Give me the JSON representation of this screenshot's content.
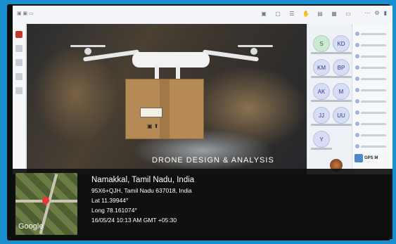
{
  "window": {
    "title_hint": "▣ ▣ ▭",
    "toolbar_icons": [
      "camera-icon",
      "mic-icon",
      "share-icon",
      "record-icon",
      "more-icon",
      "view-icon",
      "apps-icon"
    ],
    "more_icons": [
      "⋯",
      "⚙",
      "✕"
    ]
  },
  "video": {
    "caption": "DRONE DESIGN & ANALYSIS"
  },
  "participants": [
    {
      "initials": "S",
      "style": "green"
    },
    {
      "initials": "KD",
      "style": "blue"
    },
    {
      "initials": "KM",
      "style": "blue"
    },
    {
      "initials": "BP",
      "style": "blue"
    },
    {
      "initials": "AK",
      "style": "blue"
    },
    {
      "initials": "M",
      "style": "blue"
    },
    {
      "initials": "JJ",
      "style": "blue"
    },
    {
      "initials": "UU",
      "style": "blue"
    },
    {
      "initials": "Y",
      "style": "blue"
    }
  ],
  "gps_panel": {
    "label": "GPS M"
  },
  "location": {
    "place": "Namakkal, Tamil Nadu, India",
    "address": "95X6+QJH, Tamil Nadu 637018, India",
    "lat": "Lat 11.39944°",
    "long": "Long 78.161074°",
    "datetime": "16/05/24 10:13 AM GMT +05:30",
    "map_brand": "Google"
  }
}
